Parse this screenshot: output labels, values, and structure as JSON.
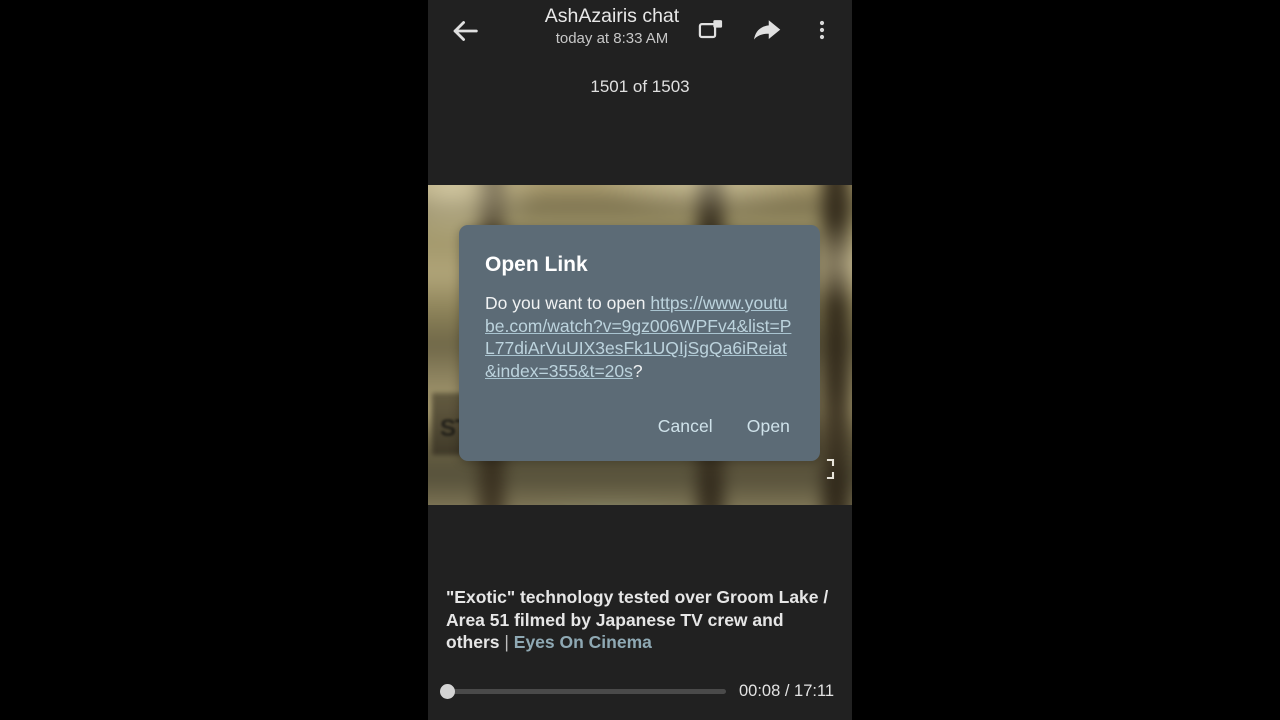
{
  "appbar": {
    "back_icon": "back-arrow-icon",
    "title": "AshAzairis chat",
    "subtitle": "today at 8:33 AM",
    "pip_icon": "picture-in-picture-icon",
    "share_icon": "share-arrow-icon",
    "more_icon": "overflow-menu-icon"
  },
  "counter": {
    "text": "1501 of 1503"
  },
  "video": {
    "fullscreen_icon": "fullscreen-corner-icon",
    "crate_label": "ST"
  },
  "dialog": {
    "title": "Open Link",
    "body_prefix": "Do you want to open ",
    "url": "https://www.youtube.com/watch?v=9gz006WPFv4&list=PL77diArVuUIX3esFk1UQIjSgQa6iReiat&index=355&t=20s",
    "body_suffix": "?",
    "cancel_label": "Cancel",
    "open_label": "Open",
    "background_color": "#5c6b76",
    "link_color": "#bcd3dd",
    "button_color": "#cfe2ea"
  },
  "caption": {
    "title": "\"Exotic\" technology tested over Groom Lake / Area 51 filmed by Japanese TV crew and others",
    "separator": " | ",
    "channel": "Eyes On Cinema",
    "channel_color": "#8fa9b4"
  },
  "player": {
    "current_time": "00:08",
    "separator": " / ",
    "duration": "17:11",
    "time_readout": "00:08 / 17:11",
    "progress_percent": 0
  }
}
